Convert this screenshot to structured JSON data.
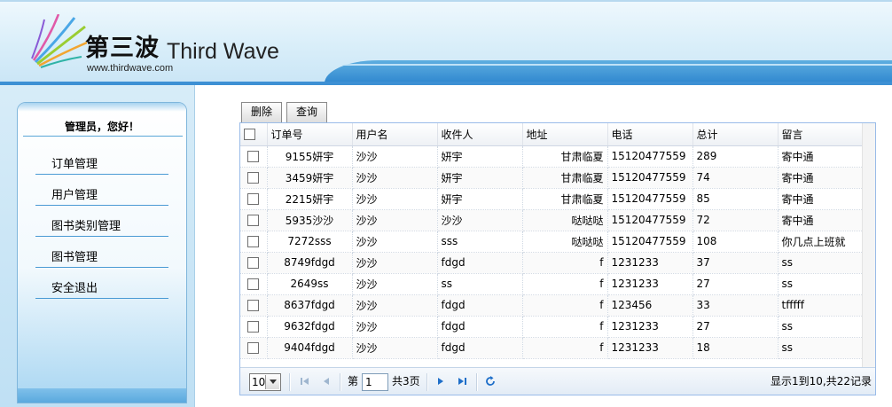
{
  "brand": {
    "name_cn": "第三波",
    "name_en": "Third Wave",
    "url": "www.thirdwave.com",
    "accent_color": "#3d90d4"
  },
  "sidebar": {
    "greeting": "管理员，您好！",
    "items": [
      {
        "label": "订单管理"
      },
      {
        "label": "用户管理"
      },
      {
        "label": "图书类别管理"
      },
      {
        "label": "图书管理"
      },
      {
        "label": "安全退出"
      }
    ]
  },
  "toolbar": {
    "delete_label": "删除",
    "query_label": "查询"
  },
  "grid": {
    "columns": {
      "order_no": "订单号",
      "username": "用户名",
      "recipient": "收件人",
      "address": "地址",
      "phone": "电话",
      "total": "总计",
      "message": "留言"
    },
    "rows": [
      {
        "order_no": "9155妍宇",
        "username": "沙沙",
        "recipient": "妍宇",
        "address": "甘肃临夏",
        "phone": "15120477559",
        "total": "289",
        "message": "寄中通"
      },
      {
        "order_no": "3459妍宇",
        "username": "沙沙",
        "recipient": "妍宇",
        "address": "甘肃临夏",
        "phone": "15120477559",
        "total": "74",
        "message": "寄中通"
      },
      {
        "order_no": "2215妍宇",
        "username": "沙沙",
        "recipient": "妍宇",
        "address": "甘肃临夏",
        "phone": "15120477559",
        "total": "85",
        "message": "寄中通"
      },
      {
        "order_no": "5935沙沙",
        "username": "沙沙",
        "recipient": "沙沙",
        "address": "哒哒哒",
        "phone": "15120477559",
        "total": "72",
        "message": "寄中通"
      },
      {
        "order_no": "7272sss",
        "username": "沙沙",
        "recipient": "sss",
        "address": "哒哒哒",
        "phone": "15120477559",
        "total": "108",
        "message": "你几点上班就"
      },
      {
        "order_no": "8749fdgd",
        "username": "沙沙",
        "recipient": "fdgd",
        "address": "f",
        "phone": "1231233",
        "total": "37",
        "message": "ss"
      },
      {
        "order_no": "2649ss",
        "username": "沙沙",
        "recipient": "ss",
        "address": "f",
        "phone": "1231233",
        "total": "27",
        "message": "ss"
      },
      {
        "order_no": "8637fdgd",
        "username": "沙沙",
        "recipient": "fdgd",
        "address": "f",
        "phone": "123456",
        "total": "33",
        "message": "tfffff"
      },
      {
        "order_no": "9632fdgd",
        "username": "沙沙",
        "recipient": "fdgd",
        "address": "f",
        "phone": "1231233",
        "total": "27",
        "message": "ss"
      },
      {
        "order_no": "9404fdgd",
        "username": "沙沙",
        "recipient": "fdgd",
        "address": "f",
        "phone": "1231233",
        "total": "18",
        "message": "ss"
      }
    ]
  },
  "pager": {
    "page_size": "10",
    "page_prefix": "第",
    "current_page": "1",
    "total_pages_text": "共3页",
    "summary": "显示1到10,共22记录",
    "icons": [
      "first-page-icon",
      "prev-page-icon",
      "next-page-icon",
      "last-page-icon",
      "refresh-icon"
    ]
  }
}
